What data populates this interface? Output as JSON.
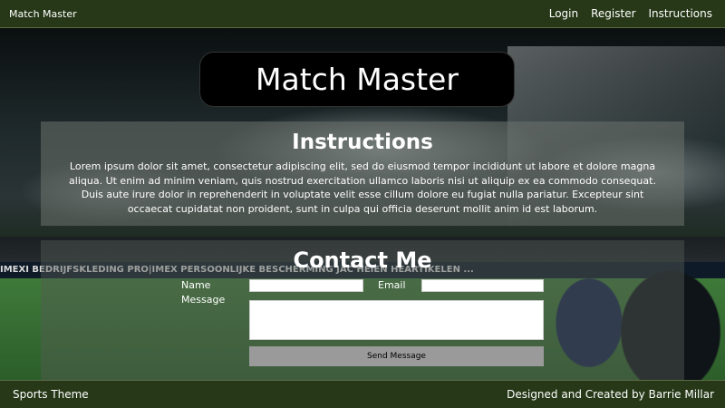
{
  "header": {
    "brand": "Match Master",
    "nav": [
      "Login",
      "Register",
      "Instructions"
    ]
  },
  "background": {
    "board_text": "IMEXI  BEDRIJFSKLEDING  PRO|IMEX  PERSOONLIJKE BESCHERMING  JAC HEIEN  HEARTIKELEN  ..."
  },
  "title": "Match Master",
  "instructions": {
    "heading": "Instructions",
    "body": "Lorem ipsum dolor sit amet, consectetur adipiscing elit, sed do eiusmod tempor incididunt ut labore et dolore magna aliqua. Ut enim ad minim veniam, quis nostrud exercitation ullamco laboris nisi ut aliquip ex ea commodo consequat. Duis aute irure dolor in reprehenderit in voluptate velit esse cillum dolore eu fugiat nulla pariatur. Excepteur sint occaecat cupidatat non proident, sunt in culpa qui officia deserunt mollit anim id est laborum."
  },
  "contact": {
    "heading": "Contact Me",
    "name_label": "Name",
    "email_label": "Email",
    "message_label": "Message",
    "name_value": "",
    "email_value": "",
    "message_value": "",
    "send_label": "Send Message"
  },
  "footer": {
    "left": "Sports Theme",
    "right": "Designed and Created by Barrie Millar"
  },
  "colors": {
    "bar": "#263817",
    "button": "#9a9a9a"
  }
}
